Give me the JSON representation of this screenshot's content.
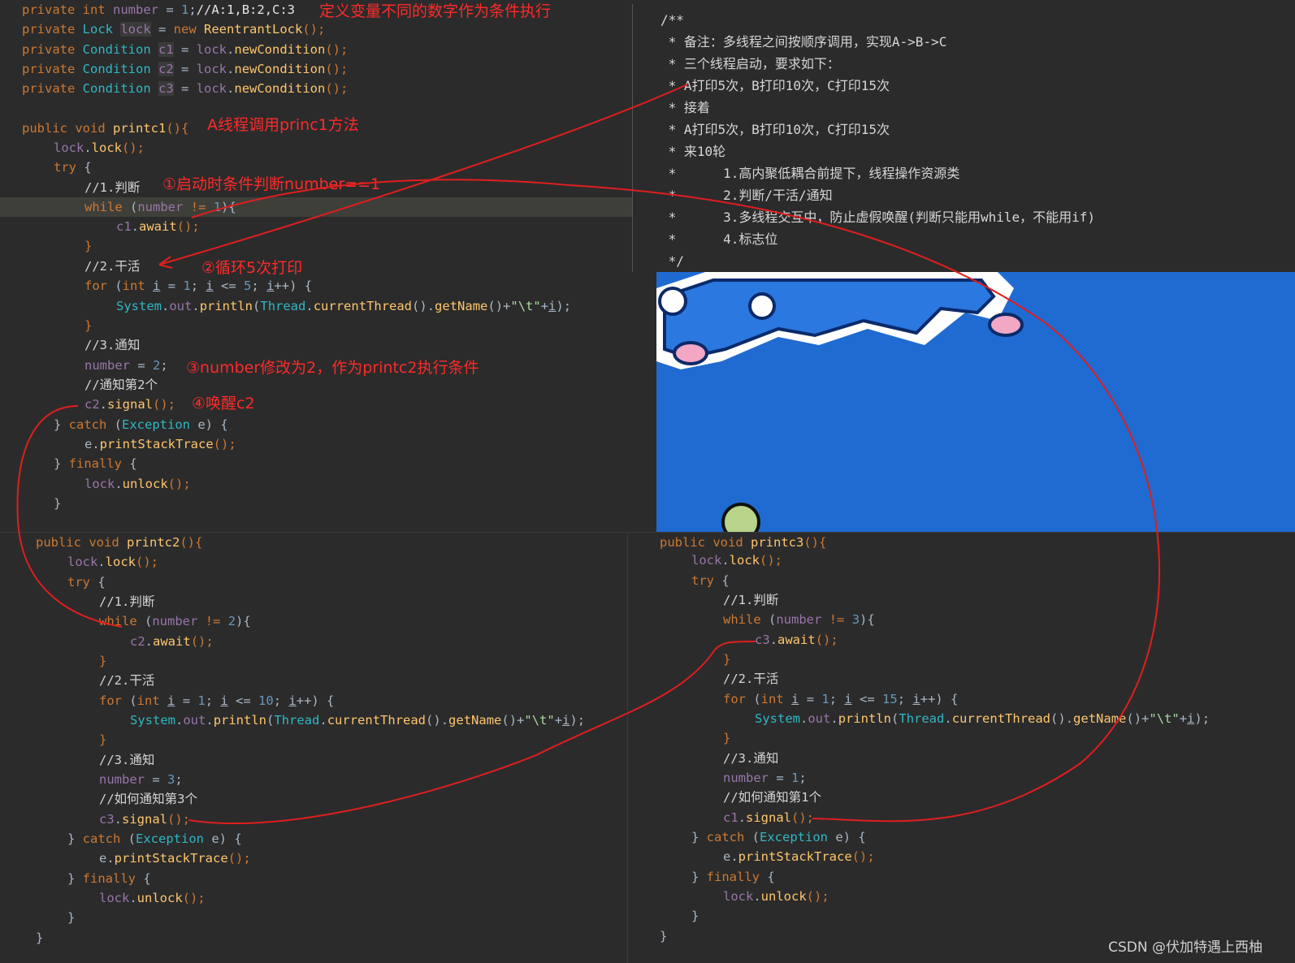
{
  "annotations": {
    "a1": "定义变量不同的数字作为条件执行",
    "a2": "A线程调用princ1方法",
    "a3": "①启动时条件判断number==1",
    "a4": "②循环5次打印",
    "a5": "③number修改为2，作为printc2执行条件",
    "a6": "④唤醒c2"
  },
  "doc": {
    "lines": [
      "/**",
      " * 备注：多线程之间按顺序调用，实现A->B->C",
      " * 三个线程启动，要求如下：",
      " * A打印5次，B打印10次，C打印15次",
      " * 接着",
      " * A打印5次，B打印10次，C打印15次",
      " * 来10轮",
      " *      1.高内聚低耦合前提下，线程操作资源类",
      " *      2.判断/干活/通知",
      " *      3.多线程交互中，防止虚假唤醒(判断只能用while，不能用if)",
      " *      4.标志位",
      " */"
    ]
  },
  "watermark": "CSDN @伏加特遇上西柚",
  "colors": {
    "code_bg": "#2b2b2b",
    "annotation": "#ff2a2a",
    "image_bg": "#1f6bd1"
  }
}
